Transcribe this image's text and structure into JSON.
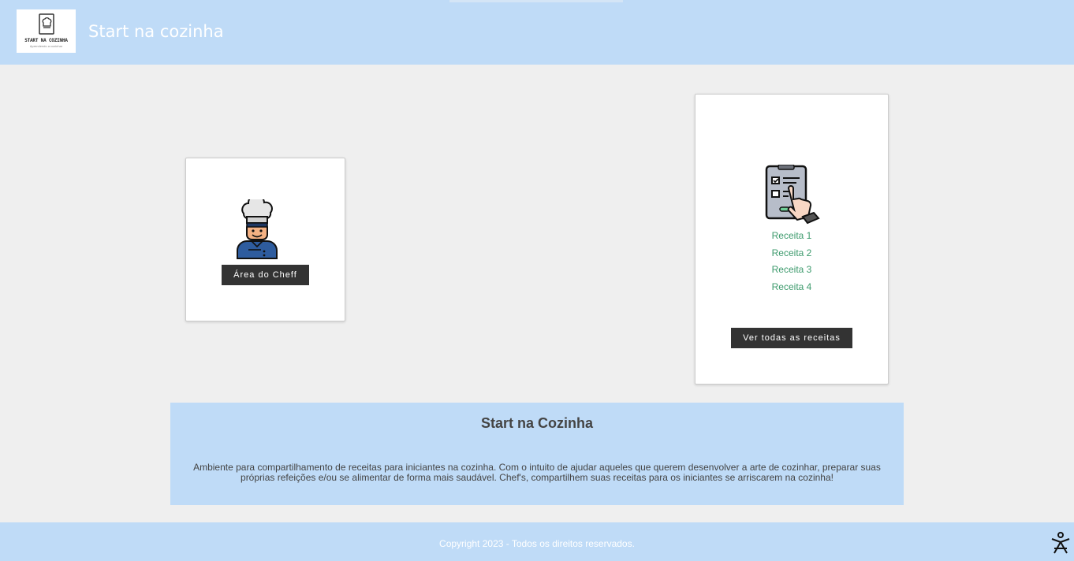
{
  "header": {
    "logo_title": "START NA COZINHA",
    "logo_subtitle": "Aprendendo a cozinhar",
    "site_title": "Start na cozinha"
  },
  "chef_card": {
    "icon": "chef-icon",
    "button_label": "Área do Cheff"
  },
  "recipes_card": {
    "icon": "recipe-checklist-icon",
    "items": [
      "Receita 1",
      "Receita 2",
      "Receita 3",
      "Receita 4"
    ],
    "button_label": "Ver todas as receitas"
  },
  "about": {
    "title": "Start na Cozinha",
    "text": "Ambiente para compartilhamento de receitas para iniciantes na cozinha. Com o intuito de ajudar aqueles que querem desenvolver a arte de cozinhar, preparar suas próprias refeições e/ou se alimentar de forma mais saudável. Chef's, compartilhem suas receitas para os iniciantes se arriscarem na cozinha!"
  },
  "footer": {
    "copyright": "Copyright 2023 - Todos os direitos reservados.",
    "corner_icon": "accessibility-icon"
  },
  "colors": {
    "header_bg": "#bfdbf7",
    "page_bg": "#efefef",
    "button_bg": "#333333",
    "link": "#3c9a6c"
  }
}
